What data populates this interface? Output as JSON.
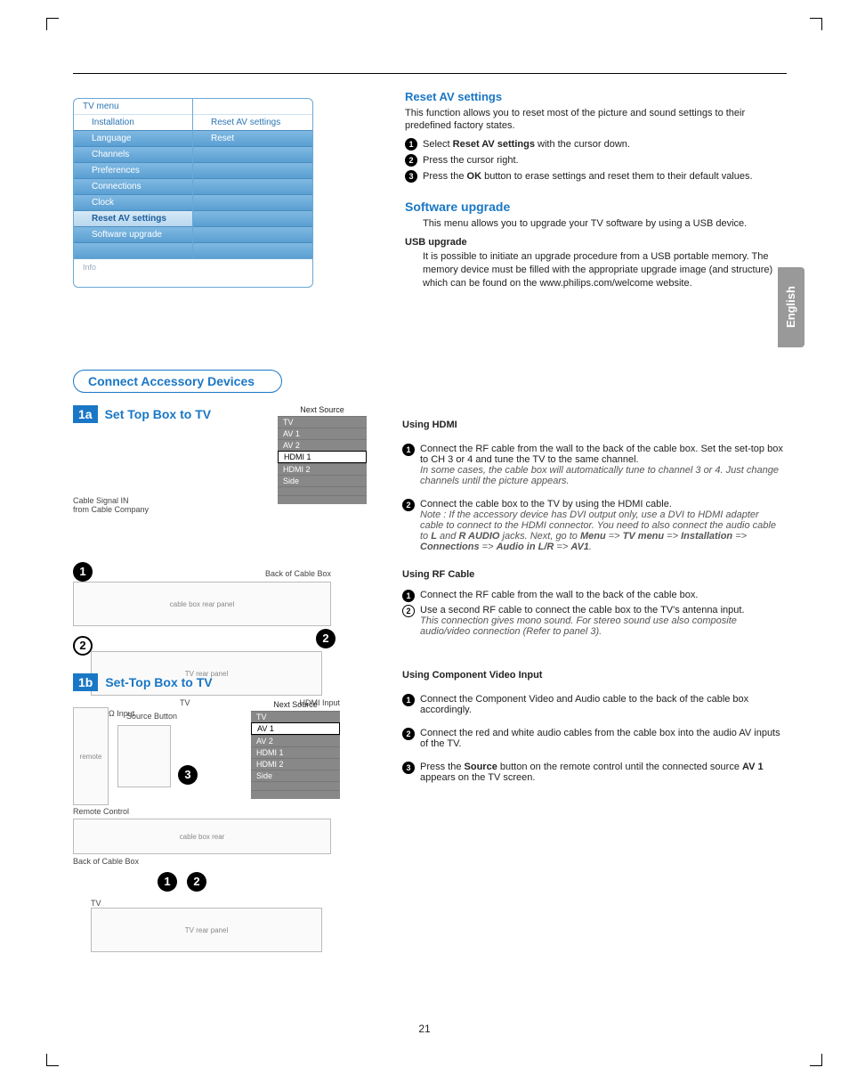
{
  "page_number": "21",
  "language_tab": "English",
  "tv_menu": {
    "header_left": "TV menu",
    "header_right": "Reset AV settings",
    "sub_left": "Installation",
    "items_left": [
      "Language",
      "Channels",
      "Preferences",
      "Connections",
      "Clock",
      "Reset AV settings",
      "Software upgrade"
    ],
    "selected_left_index": 5,
    "items_right": [
      "Reset"
    ],
    "info": "Info"
  },
  "reset_av": {
    "title": "Reset AV settings",
    "intro": "This function allows you to reset most of the picture and sound settings to their predefined factory states.",
    "steps": [
      {
        "pre": "Select ",
        "bold": "Reset AV settings",
        "post": " with the cursor down."
      },
      {
        "text": "Press the cursor right."
      },
      {
        "pre": "Press the ",
        "bold": "OK",
        "post": " button to erase settings and reset them to their default values."
      }
    ]
  },
  "software": {
    "title": "Software upgrade",
    "intro": "This menu allows you to upgrade your TV software by using a USB device.",
    "usb_title": "USB upgrade",
    "usb_body": "It is possible to initiate an upgrade procedure from a USB portable memory. The memory device must be filled with the appropriate upgrade image (and structure) which can be found on the www.philips.com/welcome website."
  },
  "connect": {
    "pill": "Connect Accessory Devices",
    "sec1a_tag": "1a",
    "sec1a_title": "Set Top Box to TV",
    "sec1b_tag": "1b",
    "sec1b_title": "Set-Top Box to TV",
    "next_source": "Next Source",
    "sources": [
      "TV",
      "AV 1",
      "AV 2",
      "HDMI 1",
      "HDMI 2",
      "Side"
    ],
    "src_sel_1a": 3,
    "src_sel_1b": 1,
    "cable_signal": "Cable Signal IN\nfrom Cable Company",
    "back_box": "Back of Cable Box",
    "tv_label": "TV",
    "hdmi_input": "HDMI Input",
    "ohm_input": "75Ω Input",
    "source_button": "Source Button",
    "remote": "Remote Control"
  },
  "hdmi": {
    "title": "Using HDMI",
    "step1_a": "Connect the RF cable from the wall to the back of the cable box. Set the set-top box to CH 3 or 4 and tune the TV to the same channel.",
    "step1_b": "In some cases, the cable box will automatically tune to channel 3 or 4. Just change channels until the picture appears.",
    "step2_a": "Connect the cable box to the TV by using the HDMI cable.",
    "step2_b_pre": "Note : If the accessory device has DVI output only, use a DVI to HDMI adapter cable to connect to the HDMI connector. You need to also connect the audio cable to ",
    "step2_b_mid1": "L",
    "step2_b_mid2": " and ",
    "step2_b_mid3": "R AUDIO",
    "step2_b_mid4": " jacks. Next, go to ",
    "step2_path": [
      "Menu",
      "TV menu",
      "Installation",
      "Connections",
      "Audio in L/R",
      "AV1"
    ]
  },
  "rf": {
    "title": "Using RF Cable",
    "step1": "Connect the RF cable from the wall to the back of the cable box.",
    "step2": "Use a second RF cable to connect the cable box to the TV's antenna input.",
    "note": "This connection gives mono sound. For stereo sound use also composite audio/video connection (Refer to panel 3)."
  },
  "component": {
    "title": "Using Component Video Input",
    "step1": "Connect the Component Video and Audio cable to the back of the cable box accordingly.",
    "step2": "Connect the red and white audio cables from the cable box into the audio AV inputs of the TV.",
    "step3_pre": "Press the ",
    "step3_b1": "Source",
    "step3_mid": " button on the remote control until the connected source ",
    "step3_b2": "AV 1",
    "step3_post": " appears on the TV screen."
  }
}
